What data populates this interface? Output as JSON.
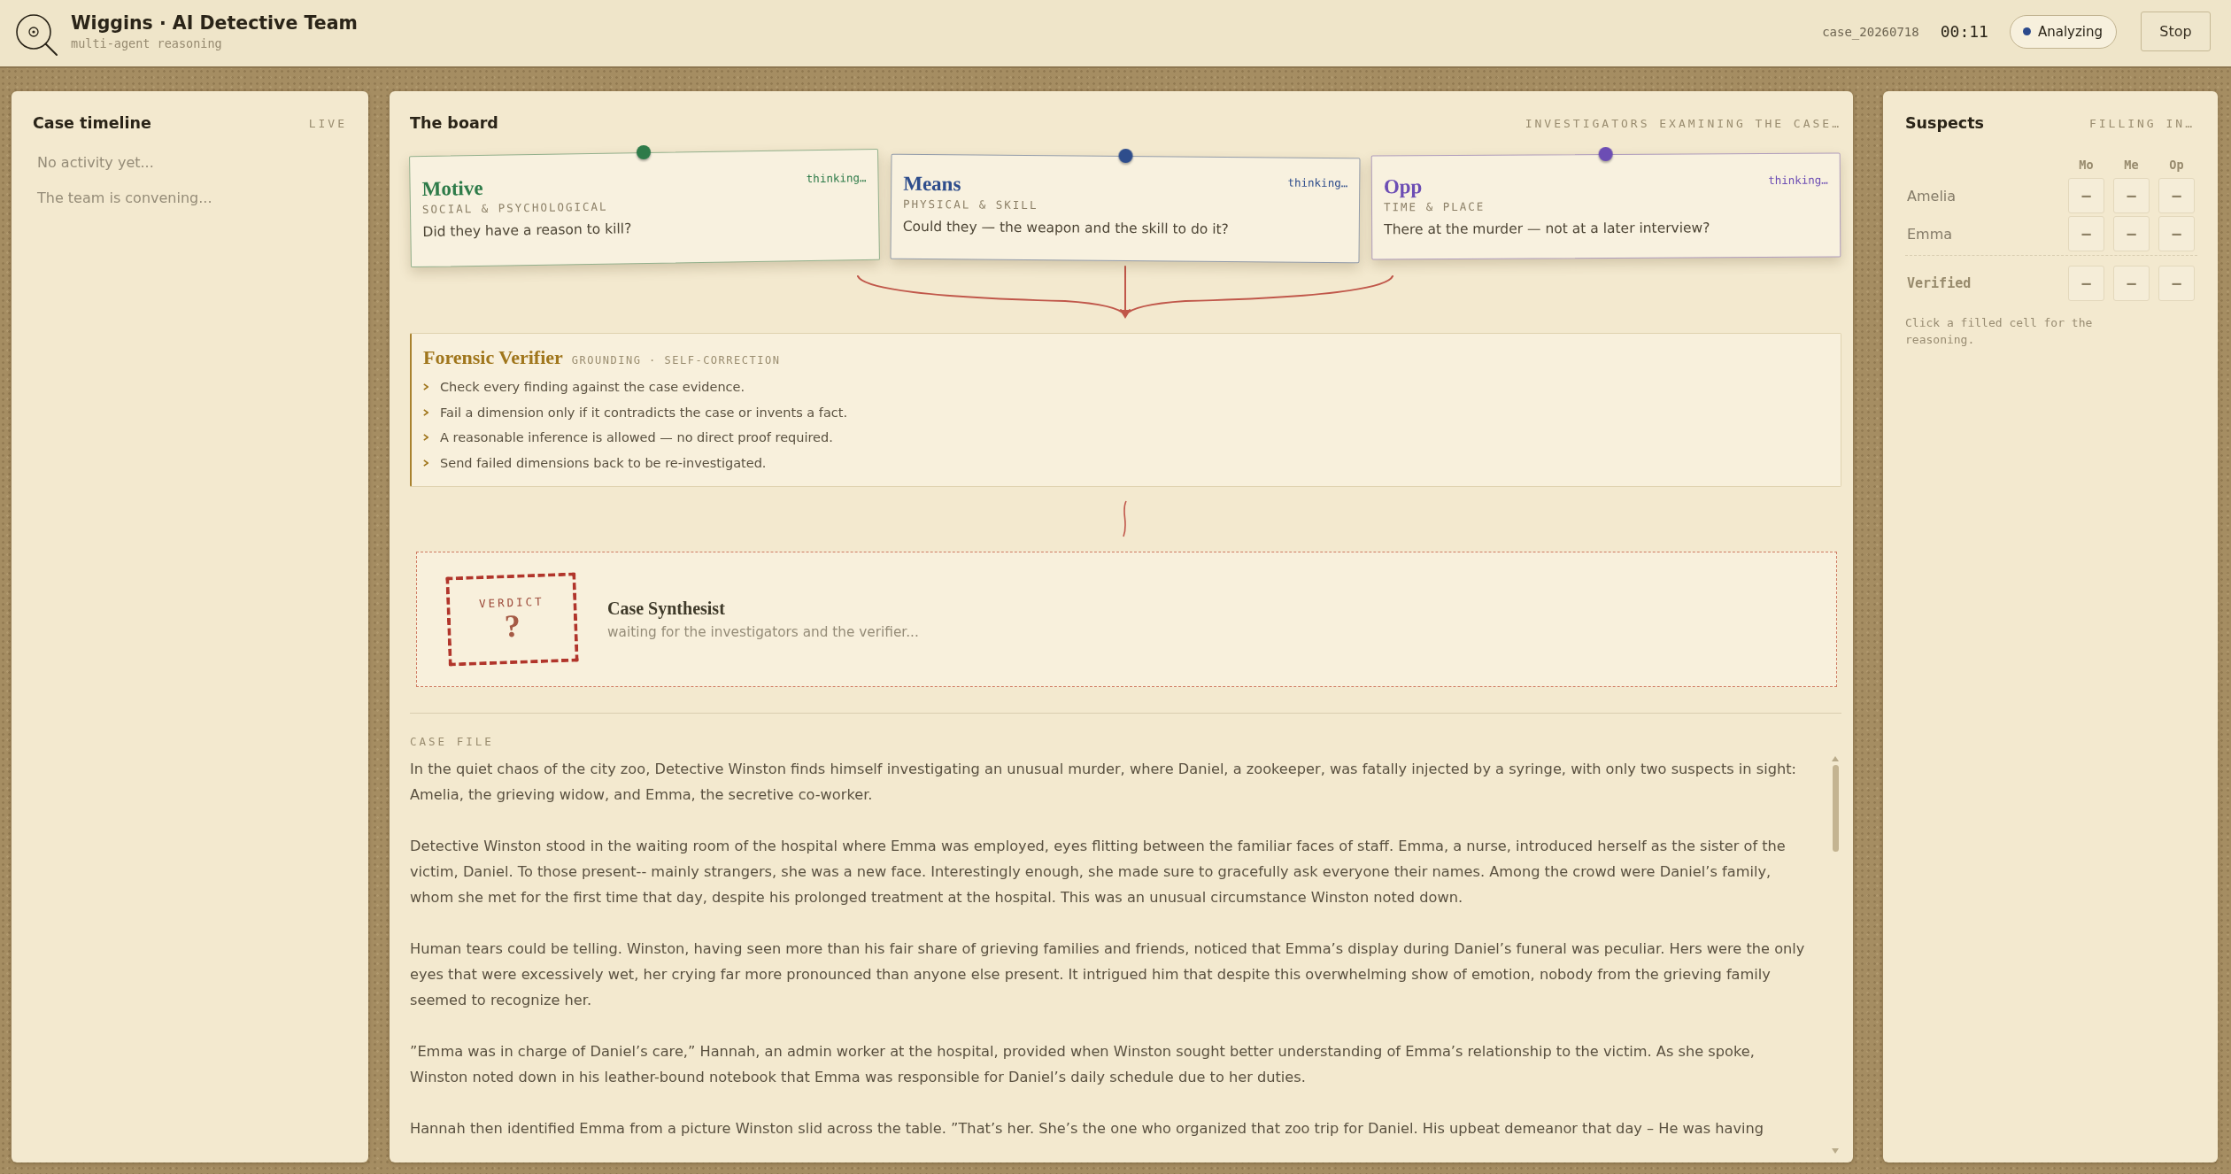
{
  "header": {
    "title": "Wiggins · AI Detective Team",
    "subtitle": "multi-agent reasoning",
    "case_id": "case_20260718",
    "timer": "00:11",
    "status": "Analyzing",
    "stop": "Stop"
  },
  "timeline": {
    "title": "Case timeline",
    "badge": "LIVE",
    "entries": [
      "No activity yet...",
      "The team is convening..."
    ]
  },
  "board": {
    "title": "The board",
    "status": "INVESTIGATORS EXAMINING THE CASE…",
    "investigators": [
      {
        "name": "Motive",
        "area": "SOCIAL & PSYCHOLOGICAL",
        "question": "Did they have a reason to kill?",
        "status": "thinking…",
        "color": "#2e7b49"
      },
      {
        "name": "Means",
        "area": "PHYSICAL & SKILL",
        "question": "Could they — the weapon and the skill to do it?",
        "status": "thinking…",
        "color": "#2e4d8c"
      },
      {
        "name": "Opp",
        "area": "TIME & PLACE",
        "question": "There at the murder — not at a later interview?",
        "status": "thinking…",
        "color": "#6c4db4"
      }
    ],
    "verifier": {
      "title": "Forensic Verifier",
      "tag": "GROUNDING · SELF-CORRECTION",
      "rules": [
        "Check every finding against the case evidence.",
        "Fail a dimension only if it contradicts the case or invents a fact.",
        "A reasonable inference is allowed — no direct proof required.",
        "Send failed dimensions back to be re-investigated."
      ]
    },
    "synthesis": {
      "stamp_label": "VERDICT",
      "verdict": "?",
      "title": "Case Synthesist",
      "status": "waiting for the investigators and the verifier..."
    }
  },
  "case_file": {
    "label": "CASE FILE",
    "paragraphs": [
      "In the quiet chaos of the city zoo, Detective Winston finds himself investigating an unusual murder, where Daniel, a zookeeper, was fatally injected by a syringe, with only two suspects in sight: Amelia, the grieving widow, and Emma, the secretive co-worker.",
      "Detective Winston stood in the waiting room of the hospital where Emma was employed, eyes flitting between the familiar faces of staff. Emma, a nurse, introduced herself as the sister of the victim, Daniel. To those present-- mainly strangers, she was a new face. Interestingly enough, she made sure to gracefully ask everyone their names. Among the crowd were Daniel’s family, whom she met for the first time that day, despite his prolonged treatment at the hospital. This was an unusual circumstance Winston noted down.",
      "Human tears could be telling. Winston, having seen more than his fair share of grieving families and friends, noticed that Emma’s display during Daniel’s funeral was peculiar. Hers were the only eyes that were excessively wet, her crying far more pronounced than anyone else present. It intrigued him that despite this overwhelming show of emotion, nobody from the grieving family seemed to recognize her.",
      "”Emma was in charge of Daniel’s care,” Hannah, an admin worker at the hospital, provided when Winston sought better understanding of Emma’s relationship to the victim. As she spoke, Winston noted down in his leather-bound notebook that Emma was responsible for Daniel’s daily schedule due to her duties.",
      "Hannah then identified Emma from a picture Winston slid across the table. ”That’s her. She’s the one who organized that zoo trip for Daniel. His upbeat demeanor that day – He was having"
    ]
  },
  "suspects": {
    "title": "Suspects",
    "status": "FILLING IN…",
    "columns": [
      "Mo",
      "Me",
      "Op"
    ],
    "rows": [
      {
        "name": "Amelia",
        "cells": [
          "–",
          "–",
          "–"
        ]
      },
      {
        "name": "Emma",
        "cells": [
          "–",
          "–",
          "–"
        ]
      }
    ],
    "verified": {
      "label": "Verified",
      "cells": [
        "–",
        "–",
        "–"
      ]
    },
    "hint": "Click a filled cell for the reasoning."
  }
}
